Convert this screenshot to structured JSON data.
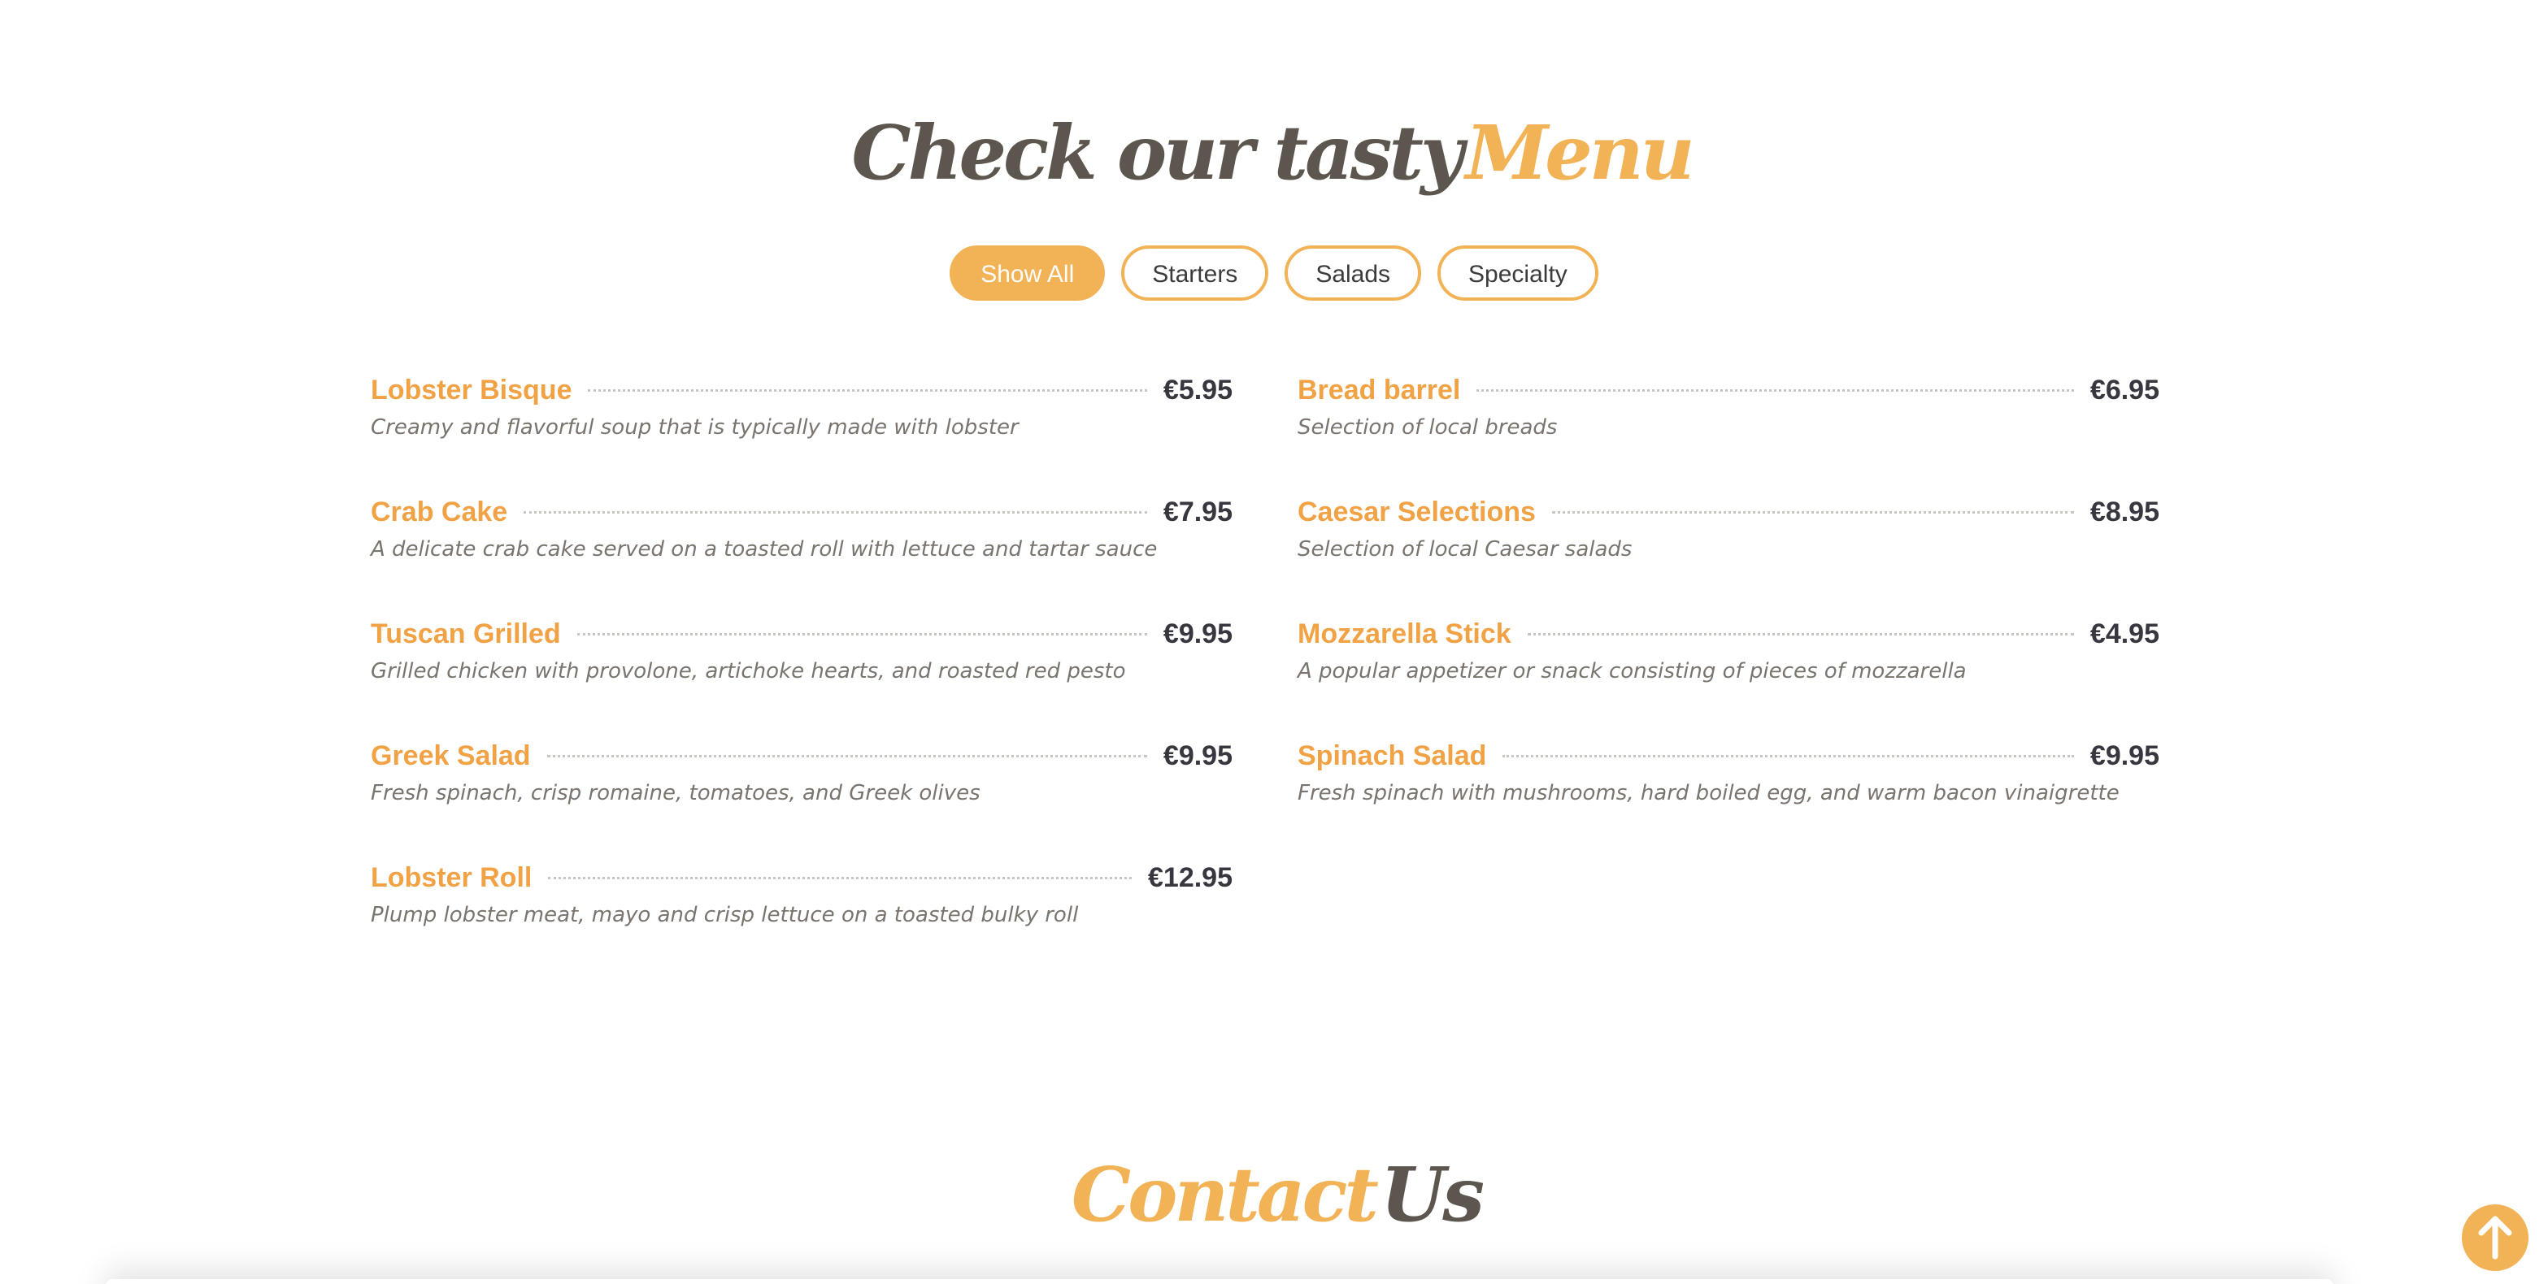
{
  "menu_section": {
    "title_dark": "Check our tasty",
    "title_accent": "Menu",
    "filters": [
      {
        "label": "Show All",
        "active": true
      },
      {
        "label": "Starters",
        "active": false
      },
      {
        "label": "Salads",
        "active": false
      },
      {
        "label": "Specialty",
        "active": false
      }
    ],
    "left_items": [
      {
        "name": "Lobster Bisque",
        "price": "€5.95",
        "desc": "Creamy and flavorful soup that is typically made with lobster"
      },
      {
        "name": "Crab Cake",
        "price": "€7.95",
        "desc": "A delicate crab cake served on a toasted roll with lettuce and tartar sauce"
      },
      {
        "name": "Tuscan Grilled",
        "price": "€9.95",
        "desc": "Grilled chicken with provolone, artichoke hearts, and roasted red pesto"
      },
      {
        "name": "Greek Salad",
        "price": "€9.95",
        "desc": "Fresh spinach, crisp romaine, tomatoes, and Greek olives"
      },
      {
        "name": "Lobster Roll",
        "price": "€12.95",
        "desc": "Plump lobster meat, mayo and crisp lettuce on a toasted bulky roll"
      }
    ],
    "right_items": [
      {
        "name": "Bread barrel",
        "price": "€6.95",
        "desc": "Selection of local breads"
      },
      {
        "name": "Caesar Selections",
        "price": "€8.95",
        "desc": "Selection of local Caesar salads"
      },
      {
        "name": "Mozzarella Stick",
        "price": "€4.95",
        "desc": "A popular appetizer or snack consisting of pieces of mozzarella"
      },
      {
        "name": "Spinach Salad",
        "price": "€9.95",
        "desc": "Fresh spinach with mushrooms, hard boiled egg, and warm bacon vinaigrette"
      }
    ]
  },
  "contact_section": {
    "title_accent": "Contact",
    "title_dark": "Us"
  },
  "back_to_top": {
    "icon": "arrow-up-icon"
  },
  "colors": {
    "accent": "#f2b256",
    "item_name": "#f0a245",
    "price": "#37373f",
    "description": "#7a746e",
    "heading_dark": "#5c564f"
  }
}
